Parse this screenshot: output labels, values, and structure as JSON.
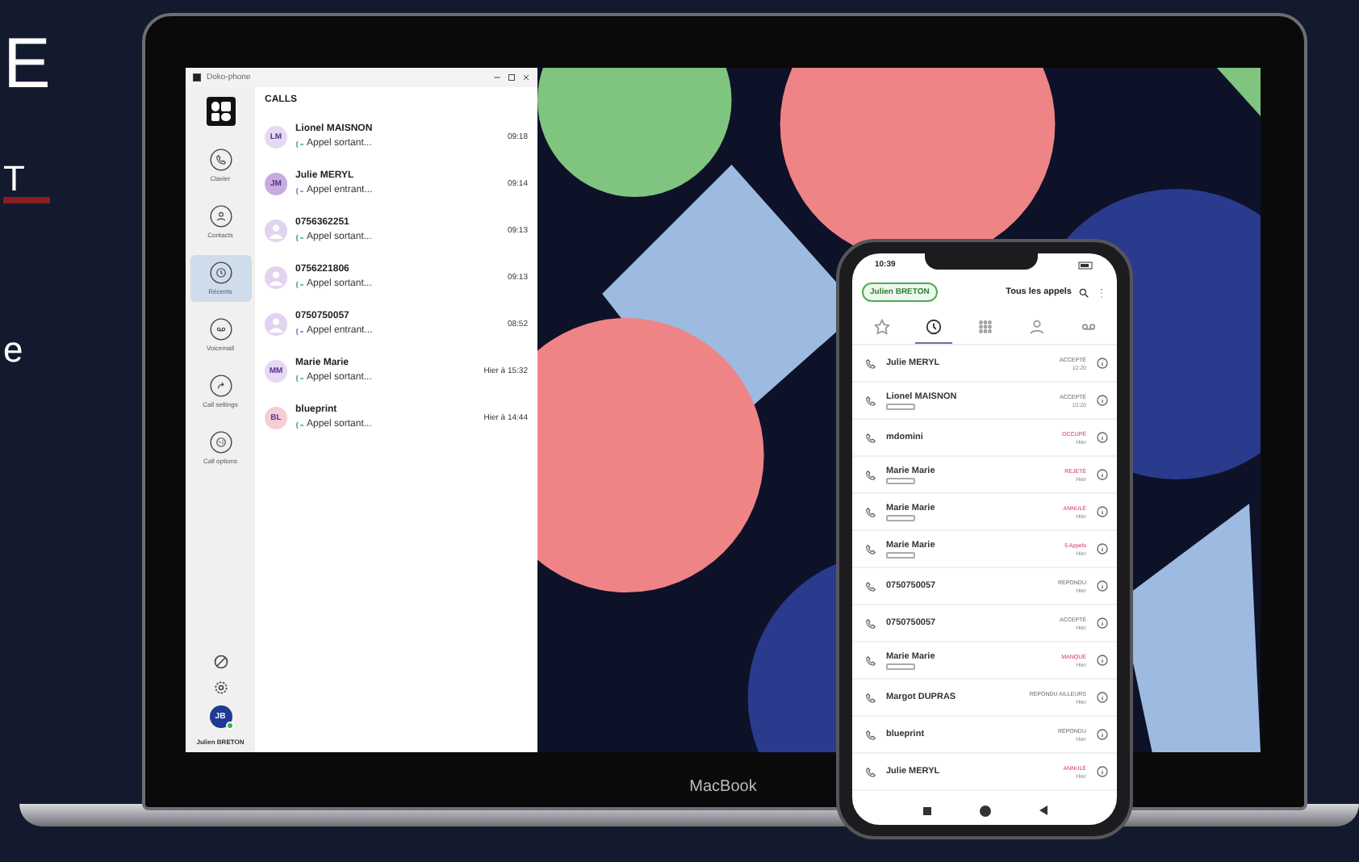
{
  "slide_text": [
    {
      "text": "E",
      "kind": "plain"
    },
    {
      "text": "T",
      "kind": "accent"
    },
    {
      "text": "e",
      "kind": "plain"
    }
  ],
  "laptop": {
    "brand": "MacBook",
    "window": {
      "title": "Doko-phone",
      "heading": "CALLS",
      "sidebar": {
        "items": [
          {
            "label": "Clavier",
            "selected": false
          },
          {
            "label": "Contacts",
            "selected": false
          },
          {
            "label": "Récents",
            "selected": true
          },
          {
            "label": "Voicemail",
            "selected": false
          },
          {
            "label": "Call settings",
            "selected": false
          },
          {
            "label": "Call options",
            "selected": false
          }
        ],
        "user": {
          "initials": "JB",
          "name": "Julien BRETON",
          "online": true
        }
      },
      "calls": [
        {
          "avatar": "LM",
          "kind": "initials",
          "color": "#e6d9f2",
          "name": "Lionel MAISNON",
          "incoming": false,
          "detail": "Appel sortant...",
          "time": "09:18"
        },
        {
          "avatar": "JM",
          "kind": "initials",
          "color": "#c6acdf",
          "name": "Julie MERYL",
          "incoming": true,
          "detail": "Appel entrant...",
          "time": "09:14"
        },
        {
          "kind": "person",
          "color": "#e2d3f0",
          "name": "0756362251",
          "incoming": false,
          "detail": "Appel sortant...",
          "time": "09:13"
        },
        {
          "kind": "person",
          "color": "#e2d3f0",
          "name": "0756221806",
          "incoming": false,
          "detail": "Appel sortant...",
          "time": "09:13"
        },
        {
          "kind": "person",
          "color": "#e2d3f0",
          "name": "0750750057",
          "incoming": true,
          "detail": "Appel entrant...",
          "time": "08:52"
        },
        {
          "avatar": "MM",
          "kind": "initials",
          "color": "#e6d9f2",
          "name": "Marie Marie",
          "incoming": false,
          "detail": "Appel sortant...",
          "time": "Hier à 15:32"
        },
        {
          "avatar": "BL",
          "kind": "initials",
          "color": "#f6cdd2",
          "name": "blueprint",
          "incoming": false,
          "detail": "Appel sortant...",
          "time": "Hier à 14:44"
        }
      ]
    }
  },
  "phone": {
    "clock": "10:39",
    "user_chip": "Julien BRETON",
    "filter": "Tous les appels",
    "tabs": [
      {
        "selected": false
      },
      {
        "selected": true
      },
      {
        "selected": false
      },
      {
        "selected": false
      },
      {
        "selected": false
      }
    ],
    "calls": [
      {
        "name": "Julie MERYL",
        "tag": false,
        "status": "ACCEPTÉ",
        "alert": false,
        "time": "10:20"
      },
      {
        "name": "Lionel MAISNON",
        "tag": true,
        "status": "ACCEPTÉ",
        "alert": false,
        "time": "10:20"
      },
      {
        "name": "mdomini",
        "tag": false,
        "status": "OCCUPÉ",
        "alert": true,
        "time": "Hier"
      },
      {
        "name": "Marie Marie",
        "tag": true,
        "status": "REJETÉ",
        "alert": true,
        "time": "Hier"
      },
      {
        "name": "Marie Marie",
        "tag": true,
        "status": "ANNULÉ",
        "alert": true,
        "time": "Hier"
      },
      {
        "name": "Marie Marie",
        "tag": true,
        "status": "5 Appels",
        "alert": true,
        "time": "Hier"
      },
      {
        "name": "0750750057",
        "tag": false,
        "status": "RÉPONDU",
        "alert": false,
        "time": "Hier"
      },
      {
        "name": "0750750057",
        "tag": false,
        "status": "ACCEPTÉ",
        "alert": false,
        "time": "Hier"
      },
      {
        "name": "Marie Marie",
        "tag": true,
        "status": "MANQUÉ",
        "alert": true,
        "time": "Hier"
      },
      {
        "name": "Margot DUPRAS",
        "tag": false,
        "status": "RÉPONDU AILLEURS",
        "alert": false,
        "time": "Hier"
      },
      {
        "name": "blueprint",
        "tag": false,
        "status": "RÉPONDU",
        "alert": false,
        "time": "Hier"
      },
      {
        "name": "Julie MERYL",
        "tag": false,
        "status": "ANNULÉ",
        "alert": true,
        "time": "Hier"
      }
    ]
  }
}
